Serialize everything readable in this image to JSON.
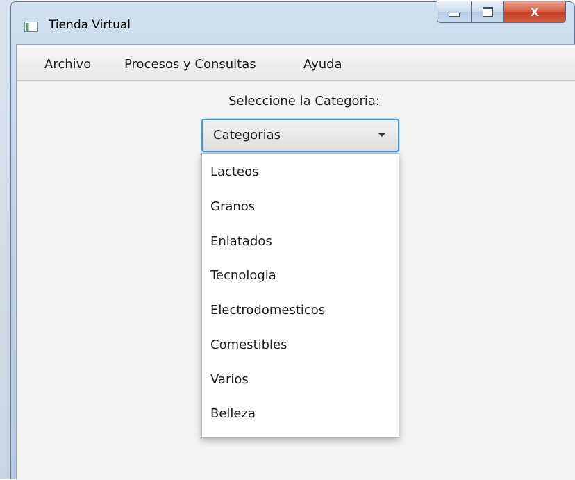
{
  "window": {
    "title": "Tienda Virtual",
    "controls": {
      "minimize": "minimize-icon",
      "maximize": "maximize-icon",
      "close": "X"
    }
  },
  "menubar": {
    "items": [
      "Archivo",
      "Procesos y Consultas",
      "Ayuda"
    ]
  },
  "form": {
    "prompt": "Seleccione la Categoria:",
    "combo": {
      "value": "Categorias",
      "options": [
        "Lacteos",
        "Granos",
        "Enlatados",
        "Tecnologia",
        "Electrodomesticos",
        "Comestibles",
        "Varios",
        "Belleza"
      ]
    }
  },
  "colors": {
    "focus": "#3c9de0",
    "close_button": "#c53b1f",
    "titlebar": "#bfd4e8"
  }
}
